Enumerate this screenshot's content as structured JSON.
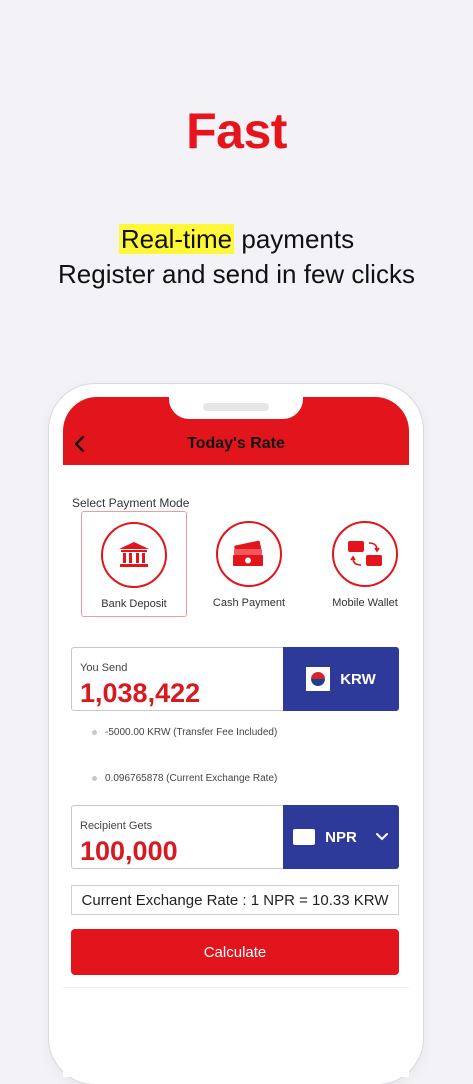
{
  "promo": {
    "headline": "Fast",
    "highlight": "Real-time",
    "line1_rest": " payments",
    "line2": "Register and send in few clicks"
  },
  "appbar": {
    "title": "Today's Rate",
    "back_icon": "chevron-left-icon"
  },
  "payment_mode": {
    "label": "Select Payment Mode",
    "options": [
      {
        "label": "Bank Deposit",
        "icon": "bank-icon",
        "selected": true
      },
      {
        "label": "Cash Payment",
        "icon": "cash-icon",
        "selected": false
      },
      {
        "label": "Mobile Wallet",
        "icon": "wallet-icon",
        "selected": false
      }
    ]
  },
  "send": {
    "caption": "You Send",
    "amount": "1,038,422",
    "currency": "KRW"
  },
  "details": {
    "fee": "-5000.00 KRW (Transfer Fee Included)",
    "rate": "0.096765878  (Current Exchange Rate)"
  },
  "receive": {
    "caption": "Recipient Gets",
    "amount": "100,000",
    "currency": "NPR"
  },
  "exchange_rate_text": "Current Exchange Rate : 1 NPR = 10.33 KRW",
  "calculate_label": "Calculate",
  "colors": {
    "brand_red": "#e3151c",
    "currency_blue": "#2e3a9a",
    "highlight": "#fff83a"
  }
}
